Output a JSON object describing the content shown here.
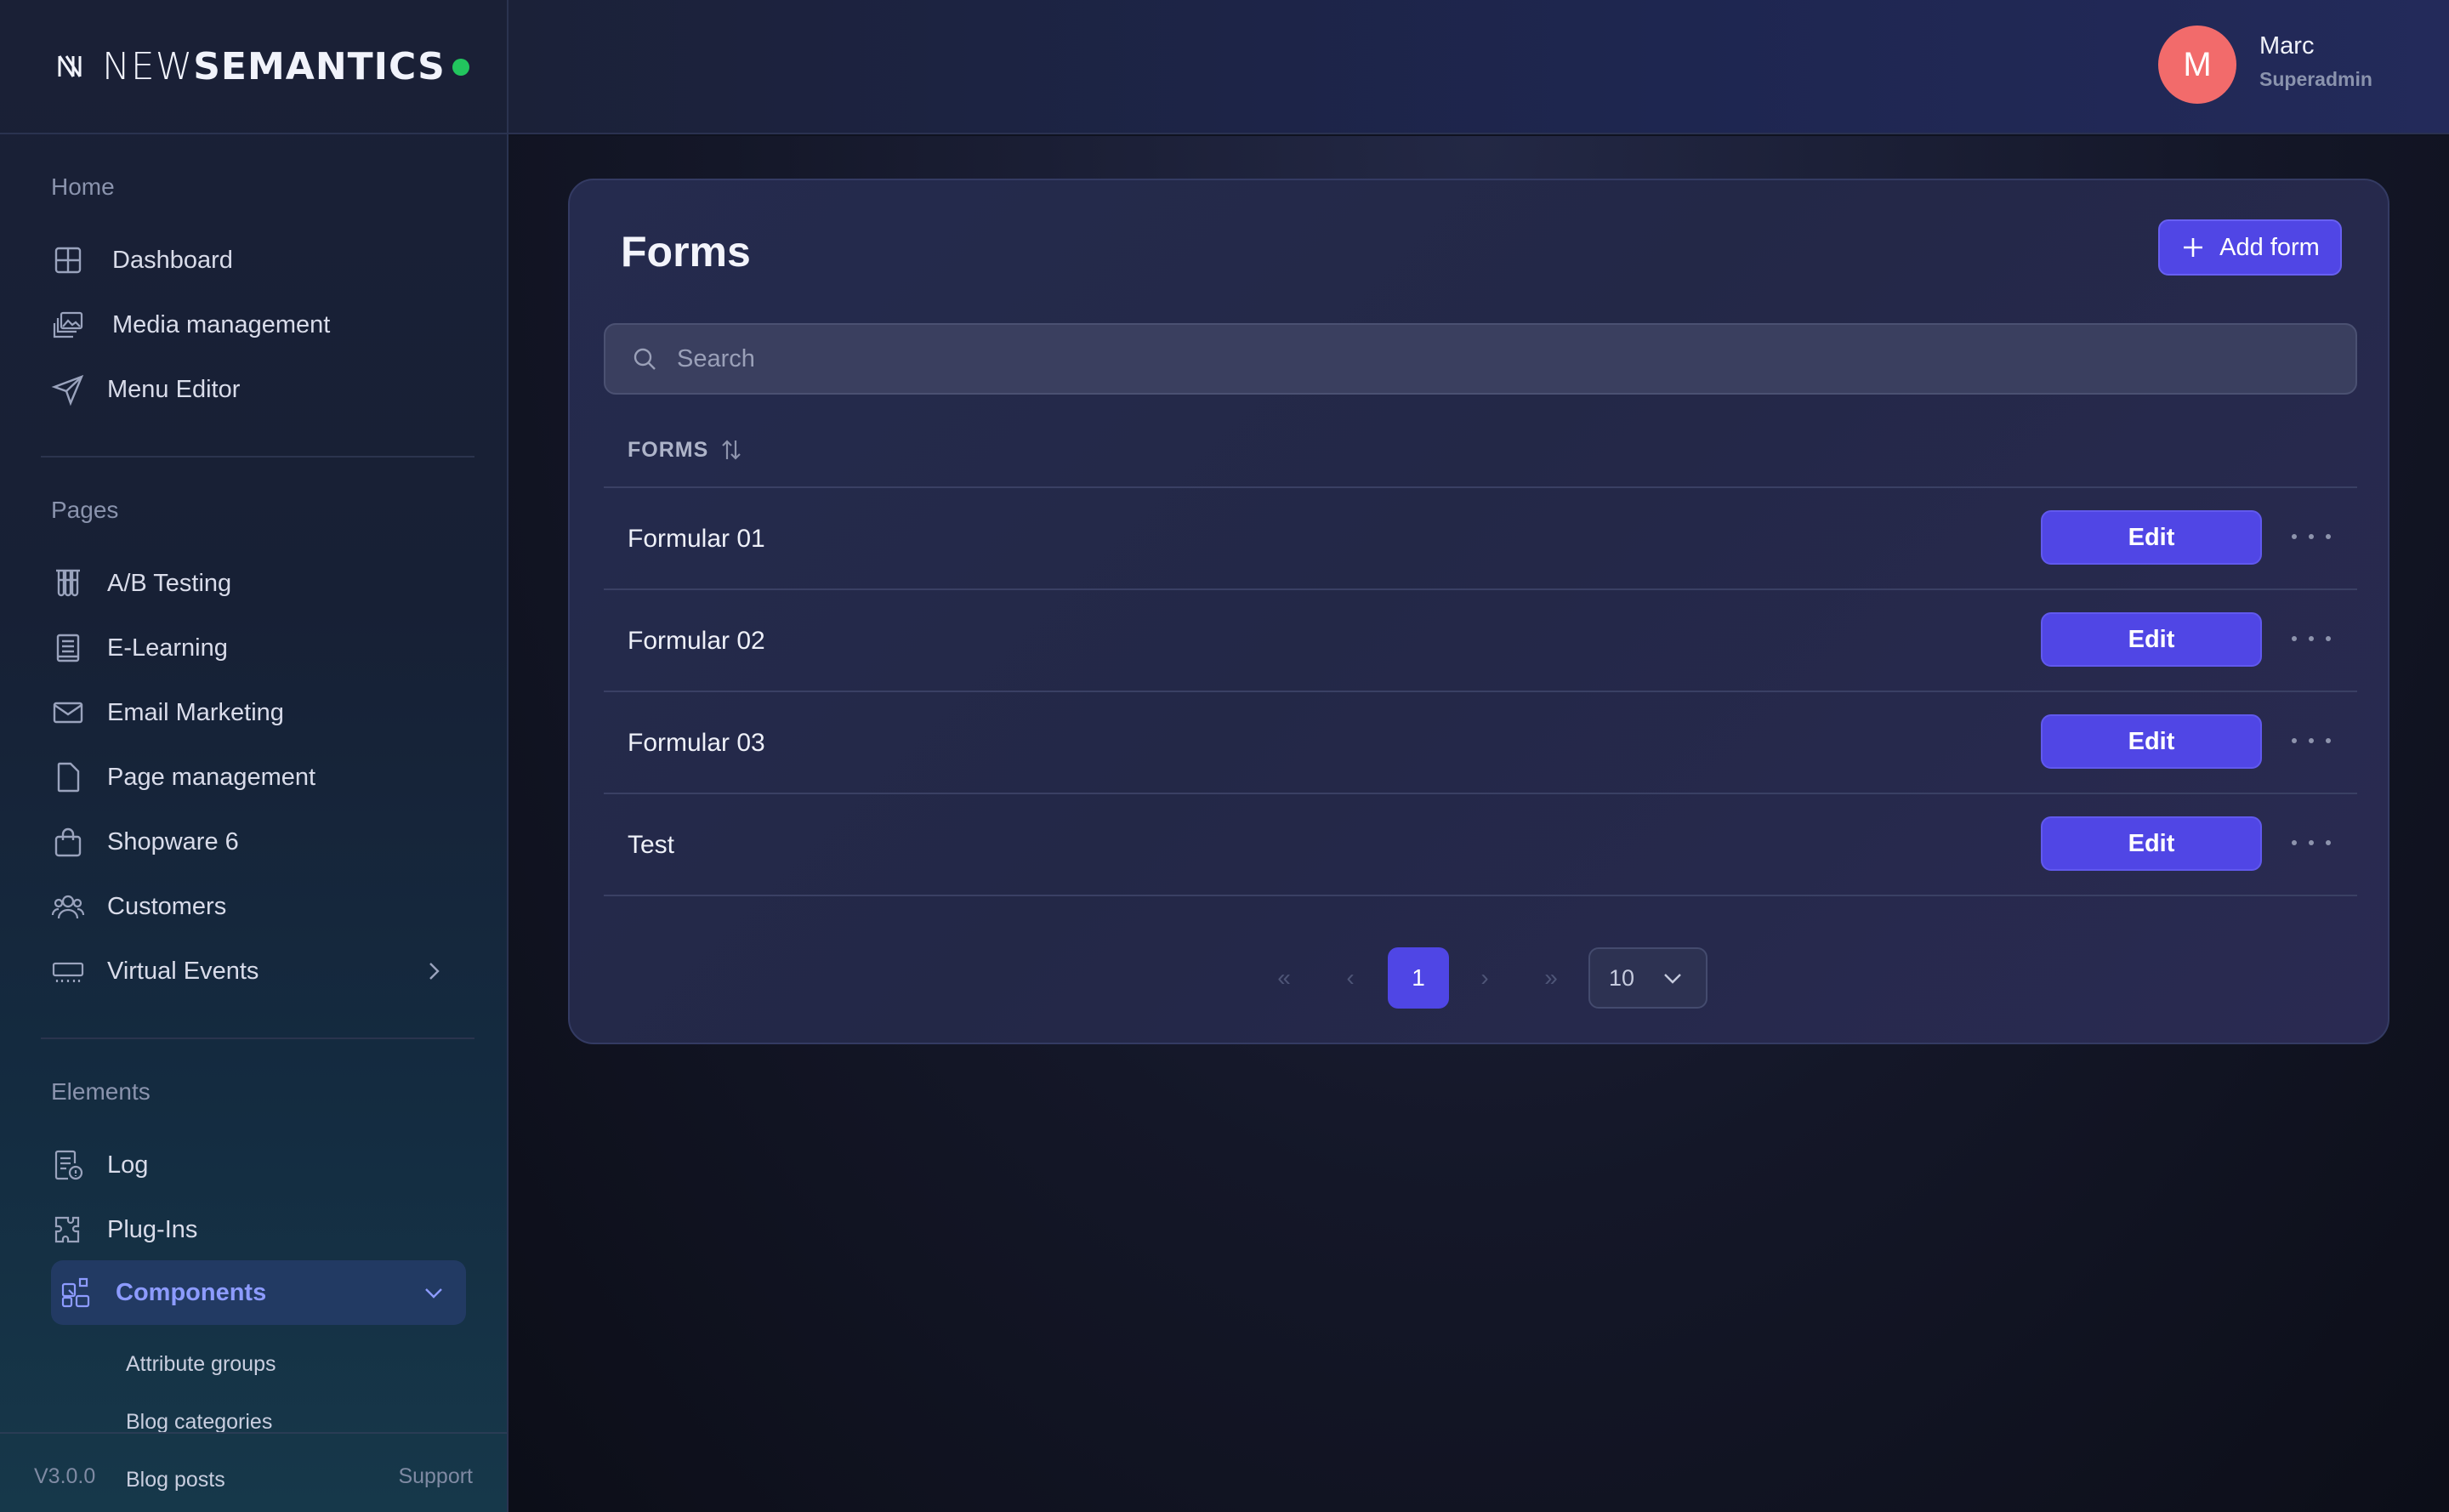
{
  "brand": {
    "name_light": "NEW",
    "name_bold": "SEMANTICS",
    "status_color": "#22c55e"
  },
  "user": {
    "initial": "M",
    "name": "Marc",
    "role": "Superadmin",
    "avatar_color": "#f26b6b"
  },
  "sidebar": {
    "sections": [
      {
        "title": "Home",
        "items": [
          {
            "label": "Dashboard",
            "icon": "grid-icon"
          },
          {
            "label": "Media management",
            "icon": "images-icon"
          },
          {
            "label": "Menu Editor",
            "icon": "send-icon"
          }
        ]
      },
      {
        "title": "Pages",
        "items": [
          {
            "label": "A/B Testing",
            "icon": "test-tubes-icon"
          },
          {
            "label": "E-Learning",
            "icon": "book-icon"
          },
          {
            "label": "Email Marketing",
            "icon": "mail-icon"
          },
          {
            "label": "Page management",
            "icon": "file-icon"
          },
          {
            "label": "Shopware 6",
            "icon": "shopping-bag-icon"
          },
          {
            "label": "Customers",
            "icon": "users-icon"
          },
          {
            "label": "Virtual Events",
            "icon": "ticket-icon"
          }
        ]
      },
      {
        "title": "Elements",
        "items": [
          {
            "label": "Log",
            "icon": "log-icon"
          },
          {
            "label": "Plug-Ins",
            "icon": "puzzle-icon"
          },
          {
            "label": "Components",
            "icon": "components-icon",
            "active": true
          }
        ]
      }
    ],
    "sub_items": [
      "Attribute groups",
      "Blog categories",
      "Blog posts"
    ],
    "footer": {
      "version": "V3.0.0",
      "support": "Support"
    }
  },
  "page": {
    "title": "Forms",
    "add_button": "Add form",
    "search_placeholder": "Search",
    "column_header": "FORMS",
    "rows": [
      {
        "name": "Formular 01",
        "action": "Edit"
      },
      {
        "name": "Formular 02",
        "action": "Edit"
      },
      {
        "name": "Formular 03",
        "action": "Edit"
      },
      {
        "name": "Test",
        "action": "Edit"
      }
    ],
    "pagination": {
      "first": "«",
      "prev": "‹",
      "current": "1",
      "next": "›",
      "last": "»",
      "per_page": "10"
    }
  },
  "colors": {
    "accent": "#4f46e5",
    "active_nav": "#8d9bff"
  }
}
